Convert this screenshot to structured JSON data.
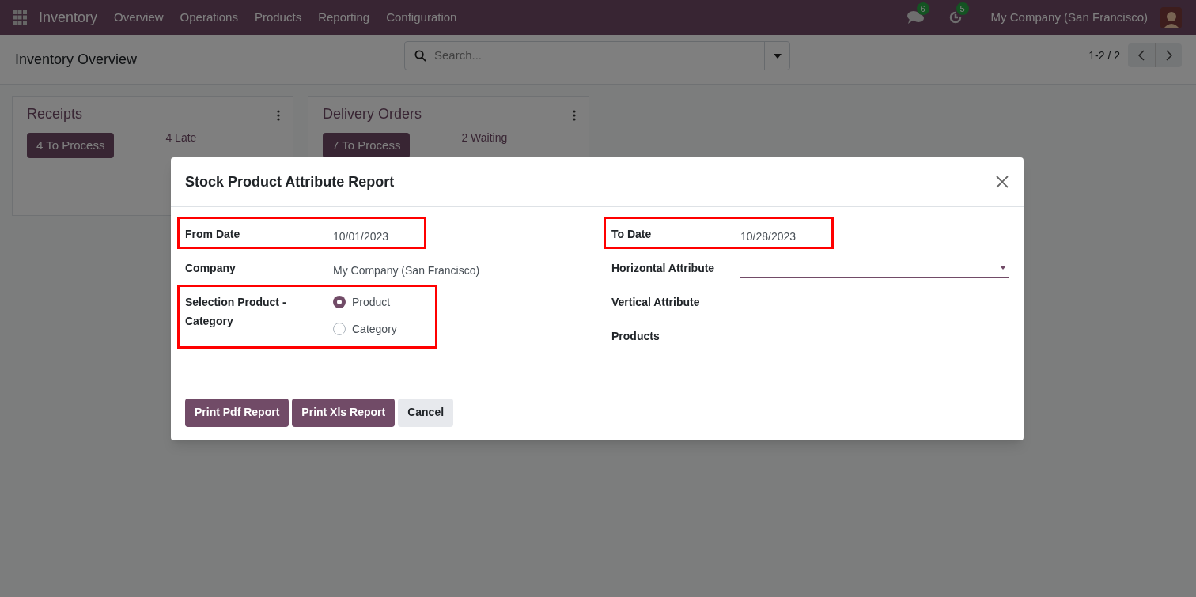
{
  "navbar": {
    "app_name": "Inventory",
    "menu": [
      "Overview",
      "Operations",
      "Products",
      "Reporting",
      "Configuration"
    ],
    "messages_count": "6",
    "activities_count": "5",
    "company": "My Company (San Francisco)"
  },
  "control_panel": {
    "title": "Inventory Overview",
    "search": {
      "placeholder": "Search..."
    },
    "pager": "1-2 / 2"
  },
  "cards": [
    {
      "title": "Receipts",
      "primary": "4 To Process",
      "secondary": "4 Late"
    },
    {
      "title": "Delivery Orders",
      "primary": "7 To Process",
      "secondary": "2 Waiting"
    }
  ],
  "dialog": {
    "title": "Stock Product Attribute Report",
    "left_fields": [
      {
        "kind": "text",
        "label": "From Date",
        "value": "10/01/2023",
        "highlighted": true
      },
      {
        "kind": "text",
        "label": "Company",
        "value": "My Company (San Francisco)",
        "highlighted": false
      },
      {
        "kind": "radio",
        "label": "Selection Product - Category",
        "options": [
          {
            "label": "Product",
            "selected": true
          },
          {
            "label": "Category",
            "selected": false
          }
        ],
        "highlighted": true
      }
    ],
    "right_fields": [
      {
        "kind": "text",
        "label": "To Date",
        "value": "10/28/2023",
        "highlighted": true
      },
      {
        "kind": "select",
        "label": "Horizontal Attribute",
        "highlighted": false
      },
      {
        "kind": "empty",
        "label": "Vertical Attribute",
        "highlighted": false
      },
      {
        "kind": "empty",
        "label": "Products",
        "highlighted": false
      }
    ],
    "buttons": [
      {
        "label": "Print Pdf Report",
        "kind": "primary"
      },
      {
        "label": "Print Xls Report",
        "kind": "primary"
      },
      {
        "label": "Cancel",
        "kind": "secondary"
      }
    ]
  }
}
